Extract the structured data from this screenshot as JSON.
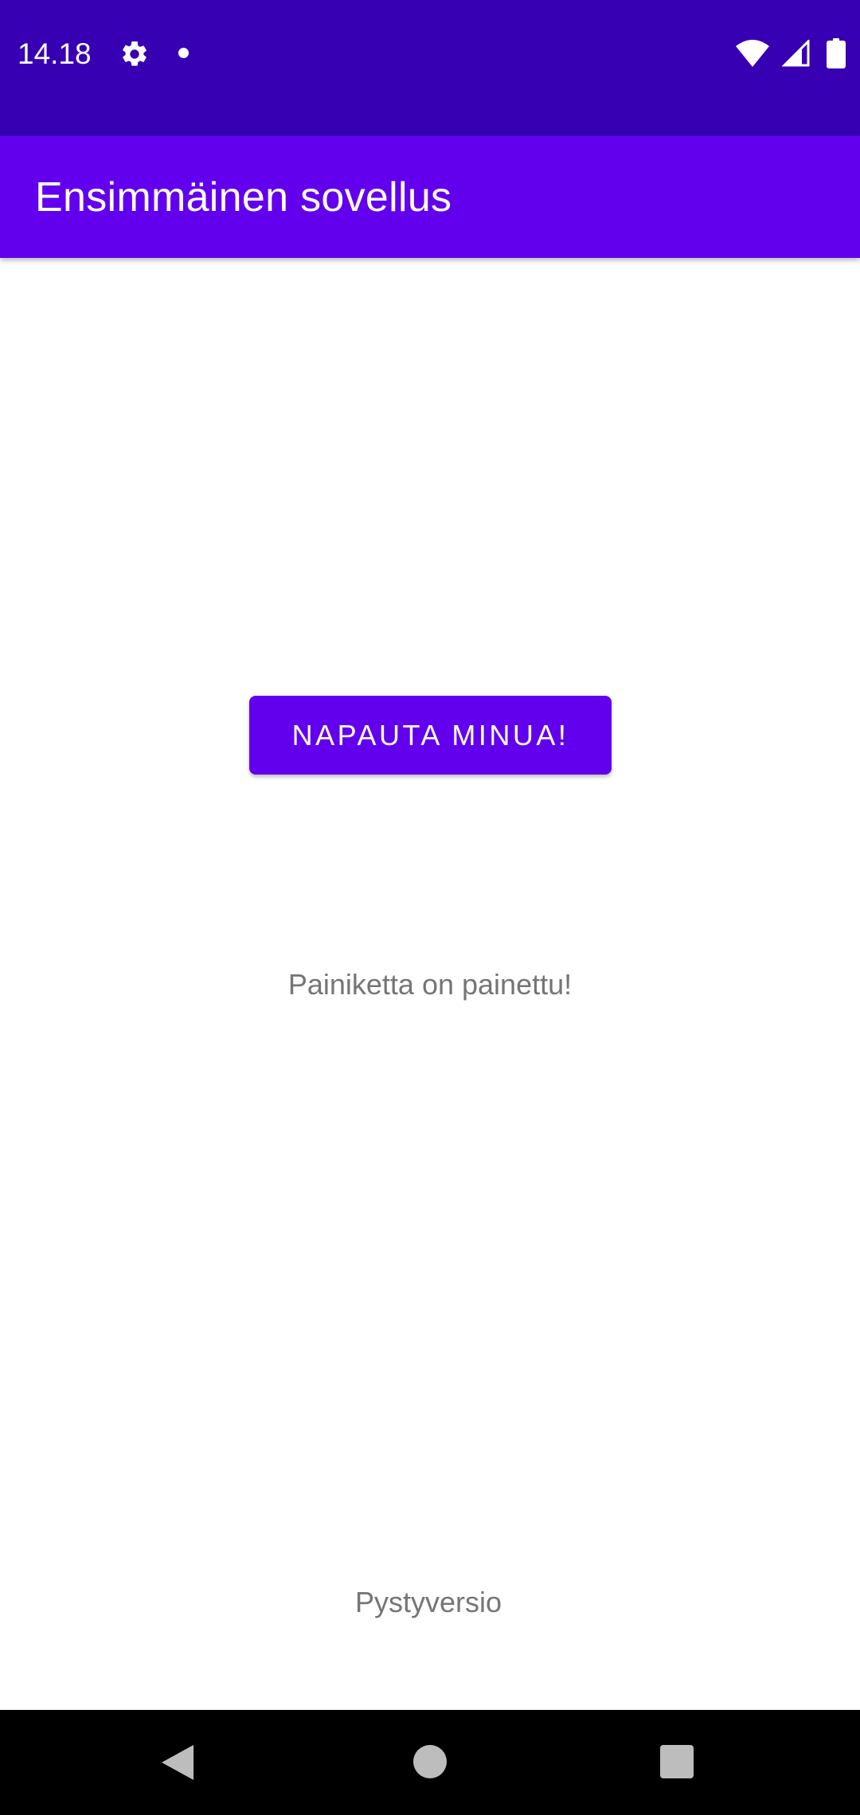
{
  "status_bar": {
    "time": "14.18",
    "icons": [
      "gear-icon",
      "notification-dot-icon",
      "wifi-icon",
      "signal-icon",
      "battery-icon"
    ],
    "background_color": "#3700B3"
  },
  "app_bar": {
    "title": "Ensimmäinen sovellus",
    "background_color": "#6200EE"
  },
  "main": {
    "button_label": "NAPAUTA MINUA!",
    "pressed_message": "Painiketta on painettu!",
    "orientation_label": "Pystyversio"
  },
  "nav_bar": {
    "icons": [
      "back-icon",
      "home-icon",
      "recents-icon"
    ]
  }
}
